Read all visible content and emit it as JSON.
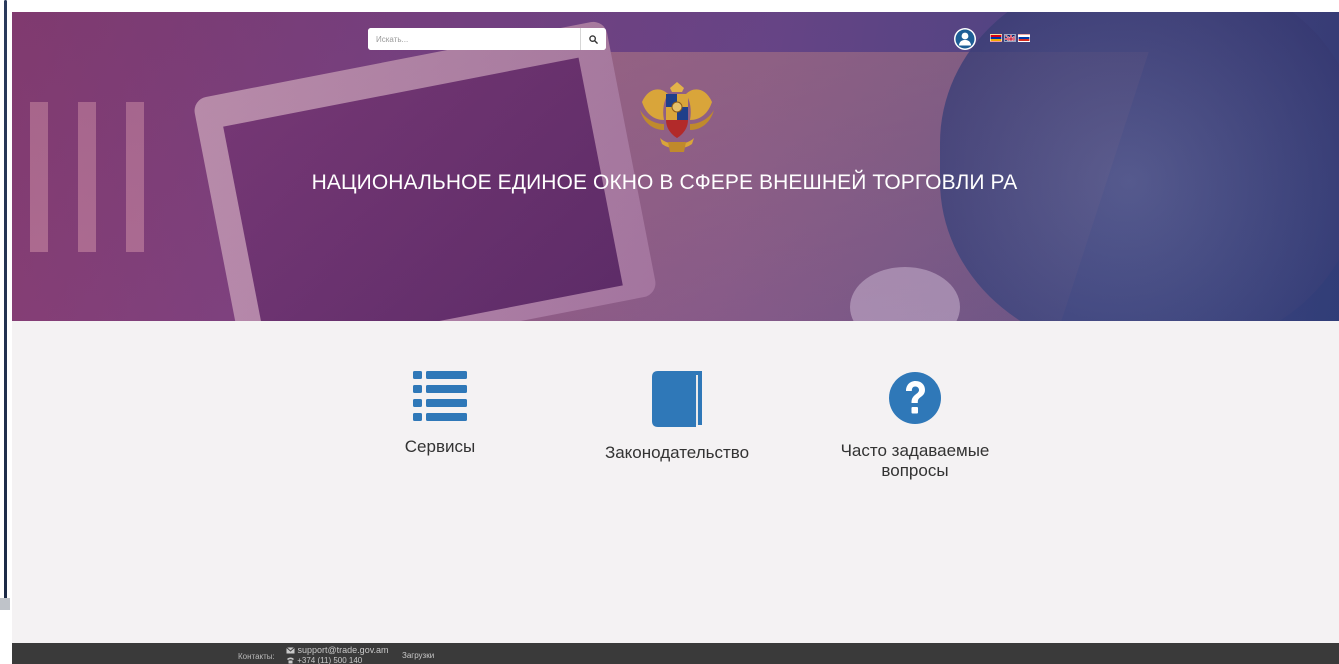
{
  "search": {
    "placeholder": "Искать..."
  },
  "header": {
    "title": "НАЦИОНАЛЬНОЕ ЕДИНОЕ ОКНО В СФЕРЕ ВНЕШНЕЙ ТОРГОВЛИ РА"
  },
  "languages": [
    "am-flag-icon",
    "en-flag-icon",
    "ru-flag-icon"
  ],
  "tiles": [
    {
      "label": "Сервисы",
      "icon": "list-icon"
    },
    {
      "label": "Законодательство",
      "icon": "book-icon"
    },
    {
      "label": "Часто задаваемые вопросы",
      "icon": "question-circle-icon"
    }
  ],
  "footer": {
    "contacts_label": "Контакты:",
    "email": "support@trade.gov.am",
    "phone": "+374 (11) 500 140",
    "downloads": "Загрузки"
  },
  "colors": {
    "accent": "#2f78b8",
    "footer_bg": "#3a3a3a",
    "content_bg": "#f4f2f3"
  }
}
